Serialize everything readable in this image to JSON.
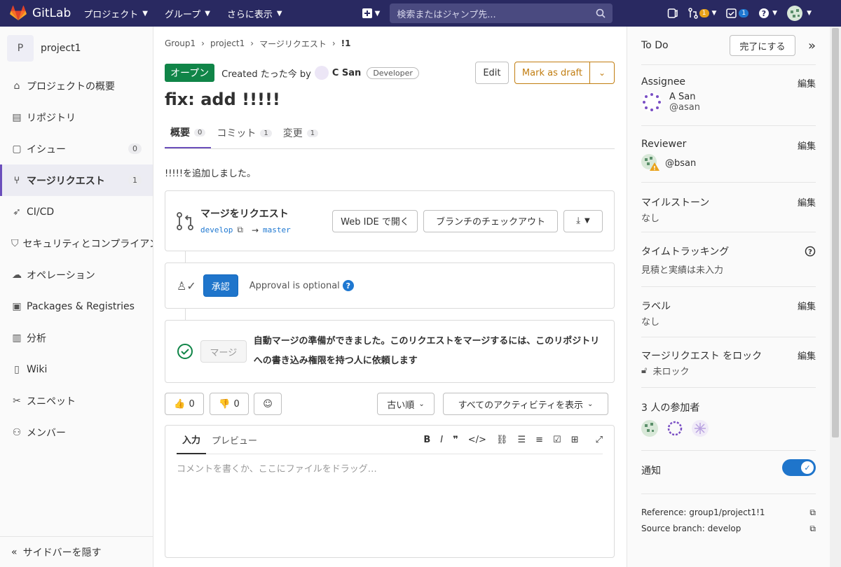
{
  "topbar": {
    "brand": "GitLab",
    "nav": [
      "プロジェクト",
      "グループ",
      "さらに表示"
    ],
    "search_placeholder": "検索またはジャンプ先...",
    "mr_count": "1",
    "todo_count": "1"
  },
  "sidebar": {
    "project_initial": "P",
    "project_name": "project1",
    "items": [
      {
        "label": "プロジェクトの概要",
        "icon": "home-icon"
      },
      {
        "label": "リポジトリ",
        "icon": "doc-icon"
      },
      {
        "label": "イシュー",
        "icon": "issues-icon",
        "count": "0"
      },
      {
        "label": "マージリクエスト",
        "icon": "merge-request-icon",
        "count": "1",
        "active": true
      },
      {
        "label": "CI/CD",
        "icon": "rocket-icon"
      },
      {
        "label": "セキュリティとコンプライアンス",
        "icon": "shield-icon"
      },
      {
        "label": "オペレーション",
        "icon": "cloud-icon"
      },
      {
        "label": "Packages & Registries",
        "icon": "package-icon"
      },
      {
        "label": "分析",
        "icon": "chart-icon"
      },
      {
        "label": "Wiki",
        "icon": "book-icon"
      },
      {
        "label": "スニペット",
        "icon": "scissors-icon"
      },
      {
        "label": "メンバー",
        "icon": "users-icon"
      }
    ],
    "collapse_label": "サイドバーを隠す"
  },
  "breadcrumb": [
    "Group1",
    "project1",
    "マージリクエスト",
    "!1"
  ],
  "mr": {
    "status": "オープン",
    "created": "Created たった今 by",
    "author": "C San",
    "role": "Developer",
    "edit_label": "Edit",
    "draft_label": "Mark as draft",
    "title": "fix: add !!!!!",
    "tabs": [
      {
        "label": "概要",
        "count": "0"
      },
      {
        "label": "コミット",
        "count": "1"
      },
      {
        "label": "変更",
        "count": "1"
      }
    ],
    "description": "!!!!!を追加しました。"
  },
  "widget": {
    "title": "マージをリクエスト",
    "source": "develop",
    "arrow": "→",
    "target": "master",
    "webide": "Web IDE で開く",
    "checkout": "ブランチのチェックアウト",
    "approve": "承認",
    "approval_text": "Approval is optional",
    "q": "?",
    "merge_btn": "マージ",
    "merge_msg": "自動マージの準備ができました。このリクエストをマージするには、このリポジトリへの書き込み権限を持つ人に依頼します"
  },
  "reactions": {
    "thumbsup": "0",
    "thumbsdown": "0",
    "sort": "古い順",
    "filter": "すべてのアクティビティを表示"
  },
  "comment": {
    "tab_write": "入力",
    "tab_preview": "プレビュー",
    "placeholder": "コメントを書くか、ここにファイルをドラッグ…"
  },
  "right": {
    "todo": "To Do",
    "done": "完了にする",
    "assignee_label": "Assignee",
    "edit": "編集",
    "assignee_name": "A San",
    "assignee_handle": "@asan",
    "reviewer_label": "Reviewer",
    "reviewer_handle": "@bsan",
    "milestone_label": "マイルストーン",
    "none": "なし",
    "time_label": "タイムトラッキング",
    "time_value": "見積と実績は未入力",
    "label_label": "ラベル",
    "lock_label": "マージリクエスト をロック",
    "lock_value": "未ロック",
    "participants": "3 人の参加者",
    "notify": "通知",
    "reference": "Reference: group1/project1!1",
    "source_branch": "Source branch: develop"
  }
}
